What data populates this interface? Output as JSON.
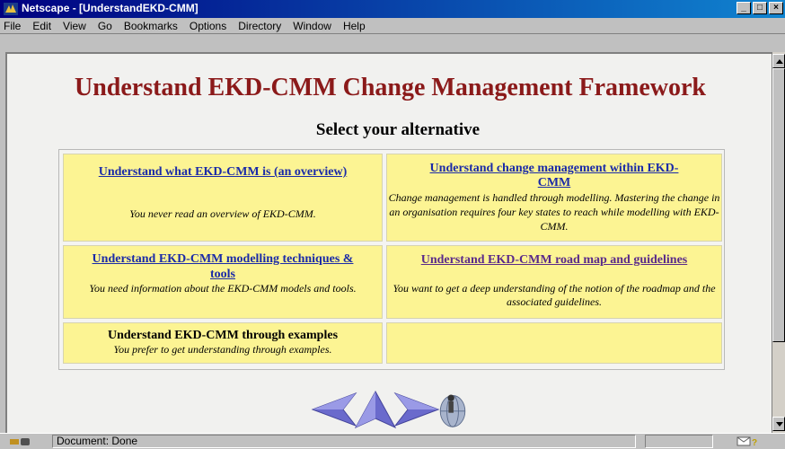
{
  "window": {
    "title": "Netscape - [UnderstandEKD-CMM]",
    "app_icon": "netscape-icon",
    "controls": [
      "_",
      "□",
      "×"
    ]
  },
  "menu": {
    "items": [
      {
        "label": "File"
      },
      {
        "label": "Edit"
      },
      {
        "label": "View"
      },
      {
        "label": "Go"
      },
      {
        "label": "Bookmarks"
      },
      {
        "label": "Options"
      },
      {
        "label": "Directory"
      },
      {
        "label": "Window"
      },
      {
        "label": "Help"
      }
    ]
  },
  "page": {
    "title": "Understand EKD-CMM Change Management Framework",
    "subtitle": "Select your alternative",
    "title_color": "#8b1a1a"
  },
  "options": [
    {
      "link": "Understand what EKD-CMM is (an overview)",
      "desc": "You never read an overview of EKD-CMM."
    },
    {
      "link": "Understand change management within EKD-CMM",
      "desc": "Change management is handled through modelling. Mastering the change in an organisation requires four key states to reach while modelling with EKD-CMM."
    },
    {
      "link": "Understand EKD-CMM modelling techniques & tools",
      "desc": "You need information about the EKD-CMM models and tools."
    },
    {
      "link": "Understand EKD-CMM road map and guidelines",
      "desc": "You want to get a deep understanding of the notion of the roadmap and the associated guidelines."
    },
    {
      "heading": "Understand EKD-CMM through examples",
      "desc": "You prefer to get understanding through examples."
    }
  ],
  "nav": {
    "icons": [
      "back-arrow-icon",
      "up-arrow-icon",
      "forward-arrow-icon",
      "globe-help-icon"
    ]
  },
  "status": {
    "text": "Document: Done",
    "icons": [
      "security-key-icon",
      "mail-icon"
    ]
  },
  "colors": {
    "cell_bg": "#fcf493",
    "link": "#1a2aa8",
    "visited_link": "#5a2a8a",
    "titlebar": "#000080"
  }
}
